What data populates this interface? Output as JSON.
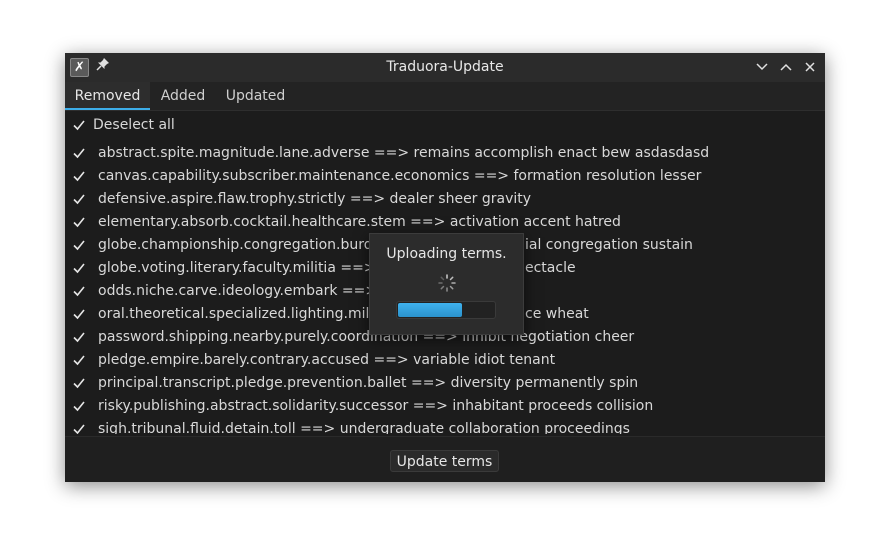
{
  "window": {
    "title": "Traduora-Update"
  },
  "tabs": [
    {
      "label": "Removed",
      "active": true
    },
    {
      "label": "Added",
      "active": false
    },
    {
      "label": "Updated",
      "active": false
    }
  ],
  "deselect_all": "Deselect all",
  "terms": [
    "abstract.spite.magnitude.lane.adverse ==> remains accomplish enact bew asdasdasd",
    "canvas.capability.subscriber.maintenance.economics ==> formation resolution lesser",
    "defensive.aspire.flaw.trophy.strictly ==> dealer sheer gravity",
    "elementary.absorb.cocktail.healthcare.stem ==> activation accent hatred",
    "globe.championship.congregation.burd",
    "globe.voting.literary.faculty.militia ==> c",
    "odds.niche.carve.ideology.embark ==> b",
    "oral.theoretical.specialized.lighting.mili",
    "password.shipping.nearby.purely.coordination ==> inhibit negotiation cheer",
    "pledge.empire.barely.contrary.accused ==> variable idiot tenant",
    "principal.transcript.pledge.prevention.ballet ==> diversity permanently spin",
    "risky.publishing.abstract.solidarity.successor ==> inhabitant proceeds collision",
    "sigh.tribunal.fluid.detain.toll ==> undergraduate collaboration proceedings"
  ],
  "terms_right_fragments": [
    "",
    "",
    "",
    "",
    "ial congregation sustain",
    "ectacle",
    "",
    "ce wheat",
    "",
    "",
    "",
    "",
    ""
  ],
  "update_button": "Update terms",
  "progress_dialog": {
    "text": "Uploading terms.",
    "progress": 0.67
  },
  "colors": {
    "accent": "#3daee9",
    "window_bg": "#1c1c1c"
  }
}
